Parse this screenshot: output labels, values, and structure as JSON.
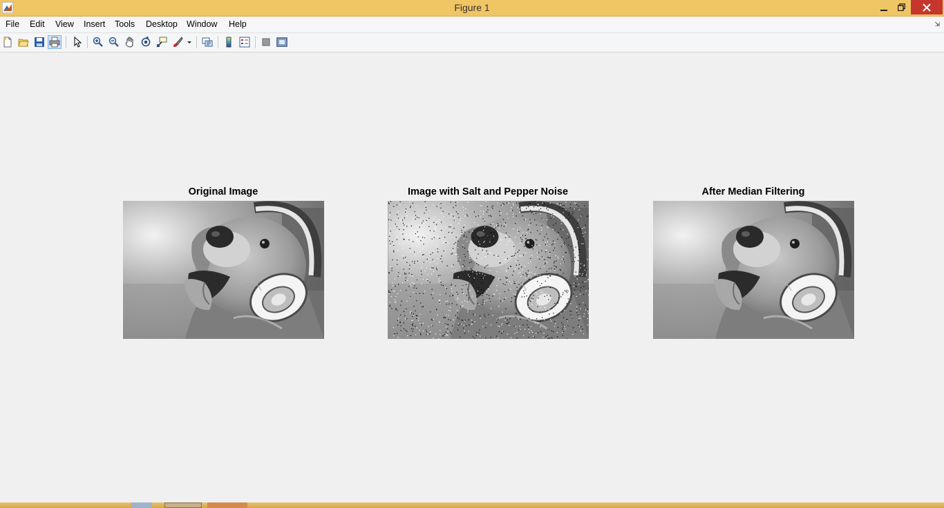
{
  "window": {
    "title": "Figure 1"
  },
  "menubar": {
    "items": [
      "File",
      "Edit",
      "View",
      "Insert",
      "Tools",
      "Desktop",
      "Window",
      "Help"
    ]
  },
  "toolbar": {
    "buttons": [
      "new-figure-icon",
      "open-file-icon",
      "save-icon",
      "print-icon",
      "edit-plot-arrow-icon",
      "zoom-in-icon",
      "zoom-out-icon",
      "pan-hand-icon",
      "rotate-3d-icon",
      "data-cursor-icon",
      "brush-icon",
      "link-plot-icon",
      "colorbar-icon",
      "legend-icon",
      "hide-plot-tools-icon",
      "show-plot-tools-icon"
    ]
  },
  "figure": {
    "panels": [
      {
        "title": "Original Image"
      },
      {
        "title": "Image with Salt and Pepper Noise"
      },
      {
        "title": "After Median Filtering"
      }
    ]
  },
  "colors": {
    "titlebar": "#f0c564",
    "close_button": "#c7362d",
    "figure_background": "#f0f0f0"
  }
}
